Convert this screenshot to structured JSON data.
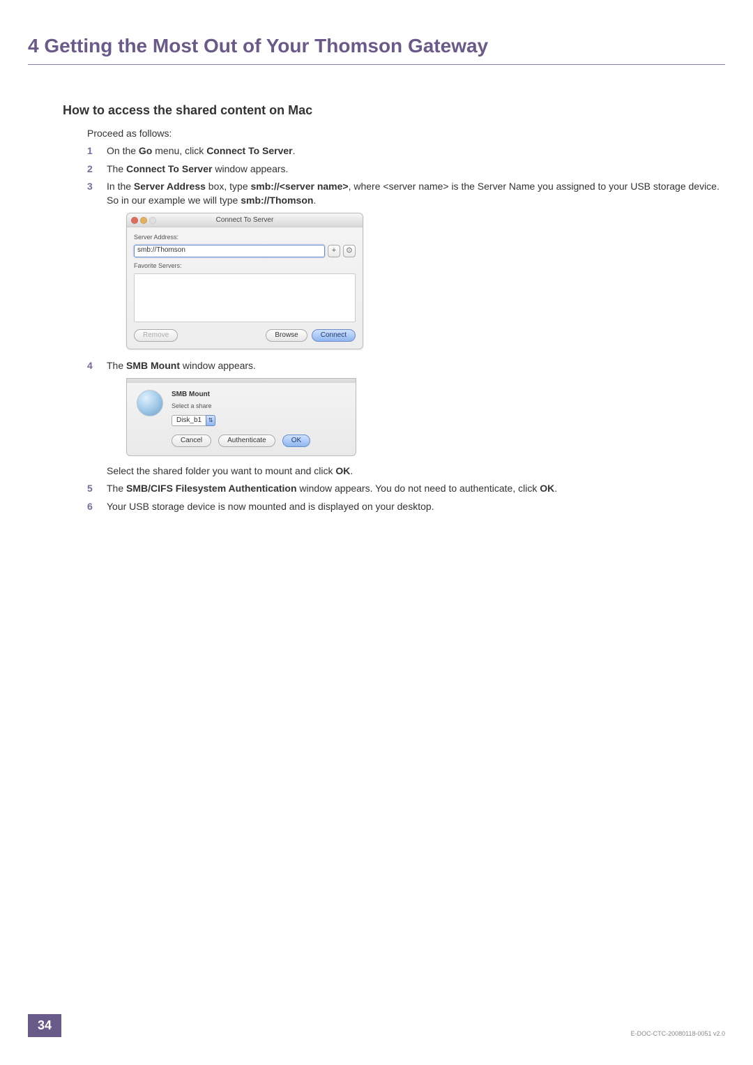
{
  "chapter": {
    "number": "4",
    "title": "Getting the Most Out of Your Thomson Gateway"
  },
  "section": {
    "title": "How to access the shared content on Mac"
  },
  "intro": "Proceed as follows:",
  "steps": [
    {
      "n": "1",
      "pre": "On the ",
      "b1": "Go",
      "mid": " menu, click ",
      "b2": "Connect To Server",
      "post": "."
    },
    {
      "n": "2",
      "pre": "The ",
      "b1": "Connect To Server",
      "post": " window appears."
    },
    {
      "n": "3",
      "pre": "In the ",
      "b1": "Server Address",
      "mid": " box, type ",
      "b2": "smb://<server name>",
      "post": ", where <server name> is the Server Name you assigned to your USB storage device. So in our example we will type ",
      "b3": "smb://Thomson",
      "tail": "."
    },
    {
      "n": "4",
      "pre": "The ",
      "b1": "SMB Mount",
      "post": " window appears."
    },
    {
      "after4": "Select the shared folder you want to mount and click ",
      "after4b": "OK",
      "after4t": "."
    },
    {
      "n": "5",
      "pre": "The ",
      "b1": "SMB/CIFS Filesystem Authentication",
      "post": " window appears. You do not need to authenticate, click ",
      "b2": "OK",
      "tail": "."
    },
    {
      "n": "6",
      "text": "Your USB storage device is now mounted and is displayed on your desktop."
    }
  ],
  "cts": {
    "title": "Connect To Server",
    "labelAddr": "Server Address:",
    "addr": "smb://Thomson",
    "plus": "+",
    "clock": "⊙",
    "labelFav": "Favorite Servers:",
    "remove": "Remove",
    "browse": "Browse",
    "connect": "Connect"
  },
  "smb": {
    "title": "SMB Mount",
    "sub": "Select a share",
    "share": "Disk_b1",
    "cancel": "Cancel",
    "auth": "Authenticate",
    "ok": "OK"
  },
  "footer": {
    "page": "34",
    "doc": "E-DOC-CTC-20080118-0051 v2.0"
  }
}
